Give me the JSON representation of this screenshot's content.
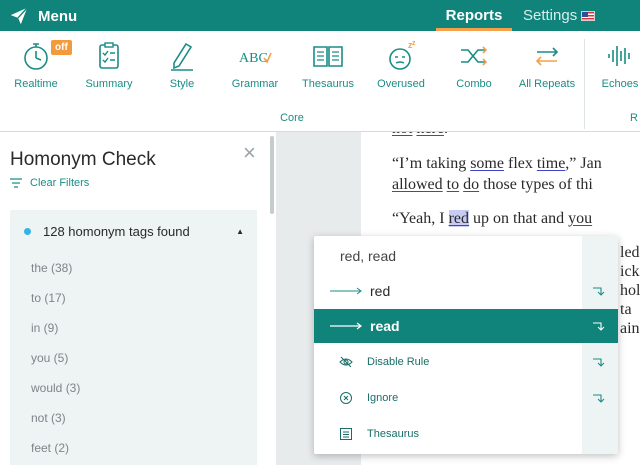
{
  "header": {
    "menu_label": "Menu",
    "tabs": [
      {
        "label": "Reports",
        "active": true
      },
      {
        "label": "Settings",
        "active": false
      }
    ]
  },
  "toolbar": {
    "tools": [
      {
        "label": "Realtime",
        "icon": "stopwatch-icon",
        "badge": "off"
      },
      {
        "label": "Summary",
        "icon": "clipboard-icon"
      },
      {
        "label": "Style",
        "icon": "pen-icon"
      },
      {
        "label": "Grammar",
        "icon": "abc-check-icon"
      },
      {
        "label": "Thesaurus",
        "icon": "book-icon"
      },
      {
        "label": "Overused",
        "icon": "sleepy-face-icon"
      },
      {
        "label": "Combo",
        "icon": "shuffle-icon"
      },
      {
        "label": "All Repeats",
        "icon": "repeat-arrows-icon"
      },
      {
        "label": "Echoes",
        "icon": "soundwave-icon"
      }
    ],
    "group_label": "Core",
    "group_label_2": "R"
  },
  "panel": {
    "title": "Homonym Check",
    "clear_filters": "Clear Filters",
    "found_label": "128 homonym tags found",
    "words": [
      "the (38)",
      "to (17)",
      "in (9)",
      "you (5)",
      "would (3)",
      "not (3)",
      "feet (2)"
    ]
  },
  "document": {
    "line1": {
      "a": "not",
      "b": "here",
      "c": "."
    },
    "line2": {
      "a": "“I’m taking ",
      "b": "some",
      "c": " flex ",
      "d": "time",
      "e": ",” Jan"
    },
    "line3": {
      "a": "allowed",
      "b": "to",
      "c": "do",
      "d": " those types of thi"
    },
    "line4": {
      "a": "“Yeah, I ",
      "b": "red",
      "c": " up on that and ",
      "d": "you"
    },
    "fragments": [
      "led",
      "ick",
      "holi",
      "ta",
      "ain."
    ]
  },
  "popup": {
    "title": "red, read",
    "suggestions": [
      {
        "label": "red",
        "active": false
      },
      {
        "label": "read",
        "active": true
      }
    ],
    "actions": [
      {
        "label": "Disable Rule",
        "icon": "eye-off-icon"
      },
      {
        "label": "Ignore",
        "icon": "circle-x-icon"
      },
      {
        "label": "Thesaurus",
        "icon": "book-icon"
      }
    ]
  },
  "colors": {
    "brand": "#10837a",
    "accent": "#f5a04a",
    "underline": "#3e45c9"
  }
}
